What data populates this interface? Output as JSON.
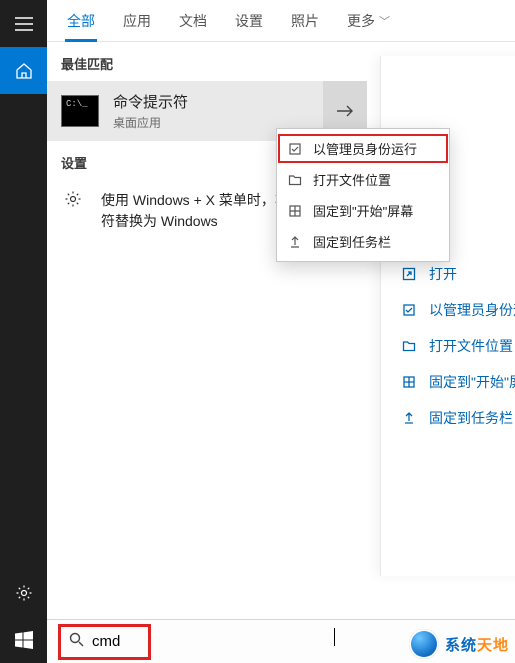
{
  "tabs": {
    "all": "全部",
    "apps": "应用",
    "docs": "文档",
    "settings": "设置",
    "photos": "照片",
    "more": "更多"
  },
  "section_best": "最佳匹配",
  "best": {
    "title": "命令提示符",
    "sub": "桌面应用"
  },
  "section_settings": "设置",
  "settings_row": "使用 Windows + X 菜单时，将命令提示符替换为 Windows",
  "ctx": {
    "run_admin": "以管理员身份运行",
    "open_loc": "打开文件位置",
    "pin_start": "固定到\"开始\"屏幕",
    "pin_task": "固定到任务栏"
  },
  "links": {
    "open": "打开",
    "run_admin": "以管理员身份运",
    "open_loc": "打开文件位置",
    "pin_start": "固定到\"开始\"屏",
    "pin_task": "固定到任务栏"
  },
  "search": {
    "value": "cmd"
  },
  "watermark": {
    "sys": "系统",
    "td": "天地"
  }
}
